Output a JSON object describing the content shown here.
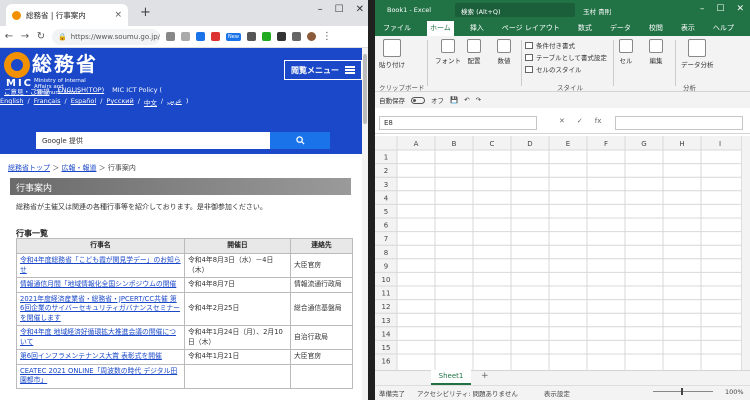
{
  "chrome": {
    "tab_title": "総務省 | 行事案内",
    "tab_close": "×",
    "new_tab": "+",
    "window_controls": [
      "–",
      "☐",
      "✕"
    ],
    "address": "https://www.soumu.go.jp/...",
    "new_badge": "New",
    "page": {
      "site_name": "総務省",
      "mic": "MIC",
      "english_name": "Ministry of Internal Affairs and Communications",
      "menu_button": "閲覧メニュー",
      "links_row1": [
        "ご意見・ご要望",
        "ENGLISH(TOP)",
        "MIC ICT Policy ("
      ],
      "links_row2": [
        "English",
        "/",
        "Français",
        "/",
        "Español",
        "/",
        "Русский",
        "/",
        "中文",
        "/",
        "عربي",
        ")"
      ],
      "search_placeholder": "Google 提供",
      "breadcrumb": [
        "総務省トップ",
        "広報・報道",
        "行事案内"
      ],
      "section_title": "行事案内",
      "intro": "総務省が主催又は関連の各種行事等を紹介しております。是非御参加ください。",
      "list_heading": "行事一覧",
      "table_headers": [
        "行事名",
        "開催日",
        "連絡先"
      ],
      "rows": [
        {
          "name": "令和4年度総務省「こども霞が関見学デー」のお知らせ",
          "date": "令和4年8月3日（水）－4日（木）",
          "contact": "大臣官房"
        },
        {
          "name": "情報通信月間「地域情報化全国シンポジウムの開催",
          "date": "令和4年8月7日",
          "contact": "情報流通行政局"
        },
        {
          "name": "2021年度経済産業省・総務省・JPCERT/CC共催 第6回企業のサイバーセキュリティガバナンスセミナーを開催します",
          "date": "令和4年2月25日",
          "contact": "総合通信基盤局"
        },
        {
          "name": "令和4年度 地域経済好循環拡大推進会議の開催について",
          "date": "令和4年1月24日（月）、2月10日（木）",
          "contact": "自治行政局"
        },
        {
          "name": "第6回インフラメンテナンス大賞 表彰式を開催",
          "date": "令和4年1月21日",
          "contact": "大臣官房"
        },
        {
          "name": "CEATEC 2021 ONLINE「周波数の時代 デジタル田園都市」",
          "date": "",
          "contact": ""
        }
      ]
    }
  },
  "excel": {
    "book": "Book1 - Excel",
    "search": "検索 (Alt+Q)",
    "user": "玉村 貴則",
    "window_controls": [
      "–",
      "☐",
      "✕"
    ],
    "tabs": [
      "ファイル",
      "ホーム",
      "挿入",
      "ページ レイアウト",
      "数式",
      "データ",
      "校閲",
      "表示",
      "ヘルプ"
    ],
    "active_tab": "ホーム",
    "ribbon": {
      "paste": "貼り付け",
      "clipboard": "クリップボード",
      "font": "フォント",
      "alignment": "配置",
      "number": "数値",
      "conditional": "条件付き書式",
      "table": "テーブルとして書式設定",
      "cellstyle": "セルのスタイル",
      "styles_group": "スタイル",
      "cells": "セル",
      "editing": "編集",
      "analyze": "データ分析",
      "analysis_group": "分析"
    },
    "qat": {
      "autosave": "自動保存",
      "off": "オフ"
    },
    "name_box": "E8",
    "fx": "fx",
    "columns": [
      "A",
      "B",
      "C",
      "D",
      "E",
      "F",
      "G",
      "H",
      "I"
    ],
    "rows": [
      "1",
      "2",
      "3",
      "4",
      "5",
      "6",
      "7",
      "8",
      "9",
      "10",
      "11",
      "12",
      "13",
      "14",
      "15",
      "16"
    ],
    "sheet_tab": "Sheet1",
    "add_sheet": "+",
    "status_ready": "準備完了",
    "status_access": "アクセシビリティ: 問題ありません",
    "status_display": "表示設定",
    "zoom": "100%"
  }
}
